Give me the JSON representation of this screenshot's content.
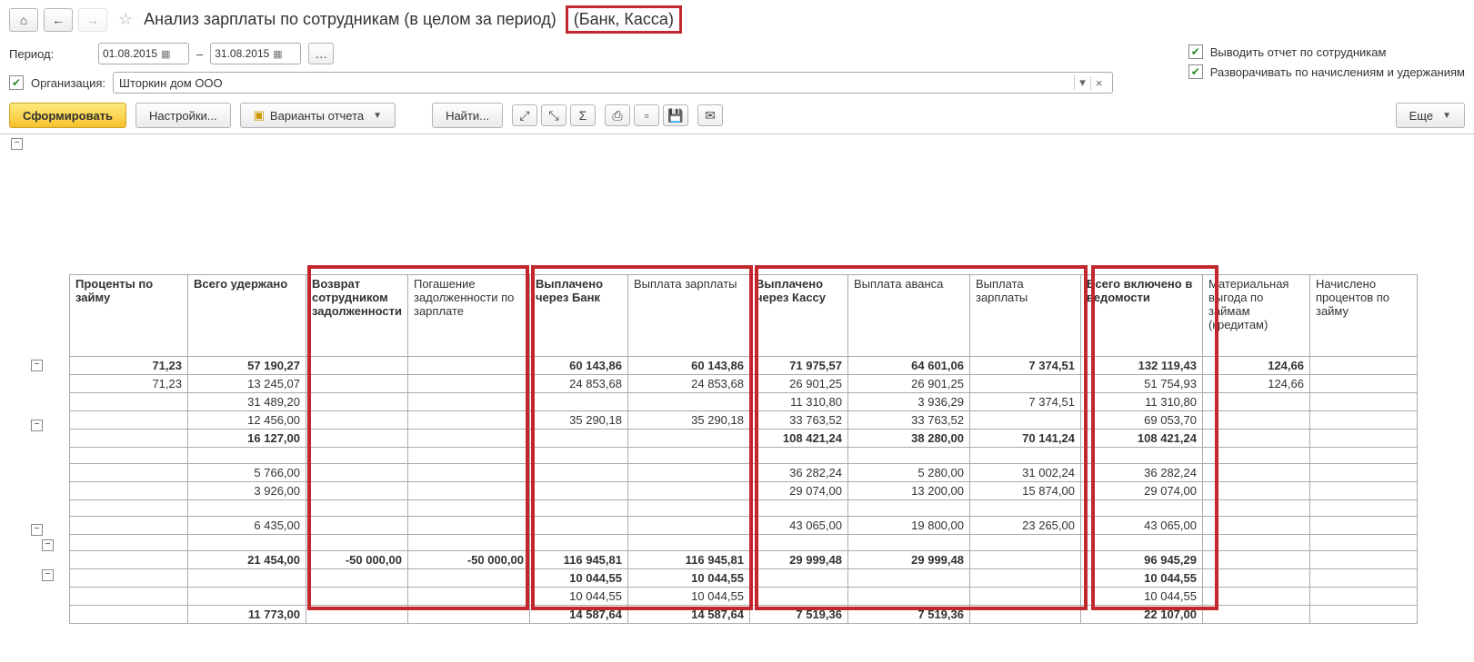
{
  "header": {
    "title_main": "Анализ зарплаты по сотрудникам (в целом за период)",
    "title_suffix": "(Банк, Касса)"
  },
  "params": {
    "period_label": "Период:",
    "date_from": "01.08.2015",
    "date_sep": "–",
    "date_to": "31.08.2015",
    "org_label": "Организация:",
    "org_value": "Шторкин дом ООО",
    "opt1": "Выводить отчет по сотрудникам",
    "opt2": "Разворачивать по начислениям и удержаниям"
  },
  "toolbar": {
    "generate": "Сформировать",
    "settings": "Настройки...",
    "variants": "Варианты отчета",
    "find": "Найти...",
    "more": "Еще"
  },
  "columns": [
    "Проценты по займу",
    "Всего удержано",
    "Возврат сотрудником задолженности",
    "Погашение задолженности по зарплате",
    "Выплачено через Банк",
    "Выплата зарплаты",
    "Выплачено через Кассу",
    "Выплата аванса",
    "Выплата зарплаты",
    "Всего включено в ведомости",
    "Материальная выгода по займам (кредитам)",
    "Начислено процентов по займу"
  ],
  "col_bold": [
    true,
    true,
    true,
    false,
    true,
    false,
    true,
    false,
    false,
    true,
    false,
    false
  ],
  "rows": [
    {
      "bold": true,
      "v": [
        "71,23",
        "57 190,27",
        "",
        "",
        "60 143,86",
        "60 143,86",
        "71 975,57",
        "64 601,06",
        "7 374,51",
        "132 119,43",
        "124,66",
        ""
      ]
    },
    {
      "bold": false,
      "v": [
        "71,23",
        "13 245,07",
        "",
        "",
        "24 853,68",
        "24 853,68",
        "26 901,25",
        "26 901,25",
        "",
        "51 754,93",
        "124,66",
        ""
      ]
    },
    {
      "bold": false,
      "v": [
        "",
        "31 489,20",
        "",
        "",
        "",
        "",
        "11 310,80",
        "3 936,29",
        "7 374,51",
        "11 310,80",
        "",
        ""
      ]
    },
    {
      "bold": false,
      "v": [
        "",
        "12 456,00",
        "",
        "",
        "35 290,18",
        "35 290,18",
        "33 763,52",
        "33 763,52",
        "",
        "69 053,70",
        "",
        ""
      ]
    },
    {
      "bold": true,
      "v": [
        "",
        "16 127,00",
        "",
        "",
        "",
        "",
        "108 421,24",
        "38 280,00",
        "70 141,24",
        "108 421,24",
        "",
        ""
      ]
    },
    {
      "bold": false,
      "v": [
        "",
        "",
        "",
        "",
        "",
        "",
        "",
        "",
        "",
        "",
        "",
        ""
      ]
    },
    {
      "bold": false,
      "v": [
        "",
        "5 766,00",
        "",
        "",
        "",
        "",
        "36 282,24",
        "5 280,00",
        "31 002,24",
        "36 282,24",
        "",
        ""
      ]
    },
    {
      "bold": false,
      "v": [
        "",
        "3 926,00",
        "",
        "",
        "",
        "",
        "29 074,00",
        "13 200,00",
        "15 874,00",
        "29 074,00",
        "",
        ""
      ]
    },
    {
      "bold": false,
      "v": [
        "",
        "",
        "",
        "",
        "",
        "",
        "",
        "",
        "",
        "",
        "",
        ""
      ]
    },
    {
      "bold": false,
      "v": [
        "",
        "6 435,00",
        "",
        "",
        "",
        "",
        "43 065,00",
        "19 800,00",
        "23 265,00",
        "43 065,00",
        "",
        ""
      ]
    },
    {
      "bold": false,
      "v": [
        "",
        "",
        "",
        "",
        "",
        "",
        "",
        "",
        "",
        "",
        "",
        ""
      ]
    },
    {
      "bold": true,
      "v": [
        "",
        "21 454,00",
        "-50 000,00",
        "-50 000,00",
        "116 945,81",
        "116 945,81",
        "29 999,48",
        "29 999,48",
        "",
        "96 945,29",
        "",
        ""
      ]
    },
    {
      "bold": true,
      "v": [
        "",
        "",
        "",
        "",
        "10 044,55",
        "10 044,55",
        "",
        "",
        "",
        "10 044,55",
        "",
        ""
      ]
    },
    {
      "bold": false,
      "v": [
        "",
        "",
        "",
        "",
        "10 044,55",
        "10 044,55",
        "",
        "",
        "",
        "10 044,55",
        "",
        ""
      ]
    },
    {
      "bold": true,
      "v": [
        "",
        "11 773,00",
        "",
        "",
        "14 587,64",
        "14 587,64",
        "7 519,36",
        "7 519,36",
        "",
        "22 107,00",
        "",
        ""
      ]
    },
    {
      "bold": false,
      "v": [
        "",
        "",
        "",
        "",
        "",
        "",
        "",
        "",
        "",
        "",
        "",
        ""
      ]
    }
  ]
}
